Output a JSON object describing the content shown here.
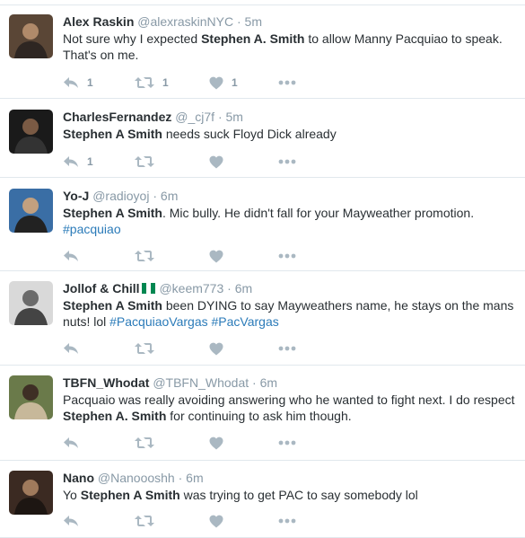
{
  "tweets": [
    {
      "name": "Alex Raskin",
      "handle": "@alexraskinNYC",
      "time": "5m",
      "segments": [
        {
          "t": "Not sure why I expected "
        },
        {
          "t": "Stephen A. Smith",
          "bold": true
        },
        {
          "t": " to allow Manny Pacquiao to speak. That's on me."
        }
      ],
      "reply_count": "1",
      "retweet_count": "1",
      "like_count": "1",
      "avatar_colors": [
        "#5a4636",
        "#b08a6a",
        "#2e2622"
      ]
    },
    {
      "name": "CharlesFernandez",
      "handle": "@_cj7f",
      "time": "5m",
      "segments": [
        {
          "t": "Stephen A Smith",
          "bold": true
        },
        {
          "t": " needs suck Floyd Dick already"
        }
      ],
      "reply_count": "1",
      "retweet_count": "",
      "like_count": "",
      "avatar_colors": [
        "#1a1a1a",
        "#7a5a44",
        "#333333"
      ]
    },
    {
      "name": "Yo-J",
      "handle": "@radioyoj",
      "time": "6m",
      "segments": [
        {
          "t": "Stephen A Smith",
          "bold": true
        },
        {
          "t": ". Mic bully.  He didn't fall for your Mayweather promotion. "
        },
        {
          "t": "#pacquiao",
          "hashtag": true
        }
      ],
      "reply_count": "",
      "retweet_count": "",
      "like_count": "",
      "avatar_colors": [
        "#3a6ea5",
        "#c2a07f",
        "#222222"
      ]
    },
    {
      "name": "Jollof & Chill",
      "flag": true,
      "handle": "@keem773",
      "time": "6m",
      "segments": [
        {
          "t": "Stephen A Smith",
          "bold": true
        },
        {
          "t": " been DYING to say Mayweathers name, he stays on the mans nuts! lol "
        },
        {
          "t": "#PacquiaoVargas",
          "hashtag": true
        },
        {
          "t": " "
        },
        {
          "t": "#PacVargas",
          "hashtag": true
        }
      ],
      "reply_count": "",
      "retweet_count": "",
      "like_count": "",
      "avatar_colors": [
        "#d9d9d9",
        "#6b6b6b",
        "#444444"
      ]
    },
    {
      "name": "TBFN_Whodat",
      "handle": "@TBFN_Whodat",
      "time": "6m",
      "segments": [
        {
          "t": "Pacquaio was really avoiding answering who he wanted to fight next. I do respect "
        },
        {
          "t": "Stephen A. Smith",
          "bold": true
        },
        {
          "t": " for continuing to ask him though."
        }
      ],
      "reply_count": "",
      "retweet_count": "",
      "like_count": "",
      "avatar_colors": [
        "#6a7a4a",
        "#3e2f25",
        "#c7b89a"
      ]
    },
    {
      "name": "Nano",
      "handle": "@Nanoooshh",
      "time": "6m",
      "segments": [
        {
          "t": "Yo "
        },
        {
          "t": "Stephen A Smith",
          "bold": true
        },
        {
          "t": " was trying to get PAC to say somebody lol"
        }
      ],
      "reply_count": "",
      "retweet_count": "",
      "like_count": "",
      "avatar_colors": [
        "#3b2a22",
        "#a07a5c",
        "#1d1612"
      ]
    }
  ],
  "colors": {
    "name": "#292f33",
    "meta": "#8899a6",
    "hashtag": "#2b7bb9",
    "divider": "#e1e8ed",
    "action_icon": "#aab8c2"
  },
  "icons": [
    "reply-icon",
    "retweet-icon",
    "like-icon",
    "more-icon"
  ]
}
